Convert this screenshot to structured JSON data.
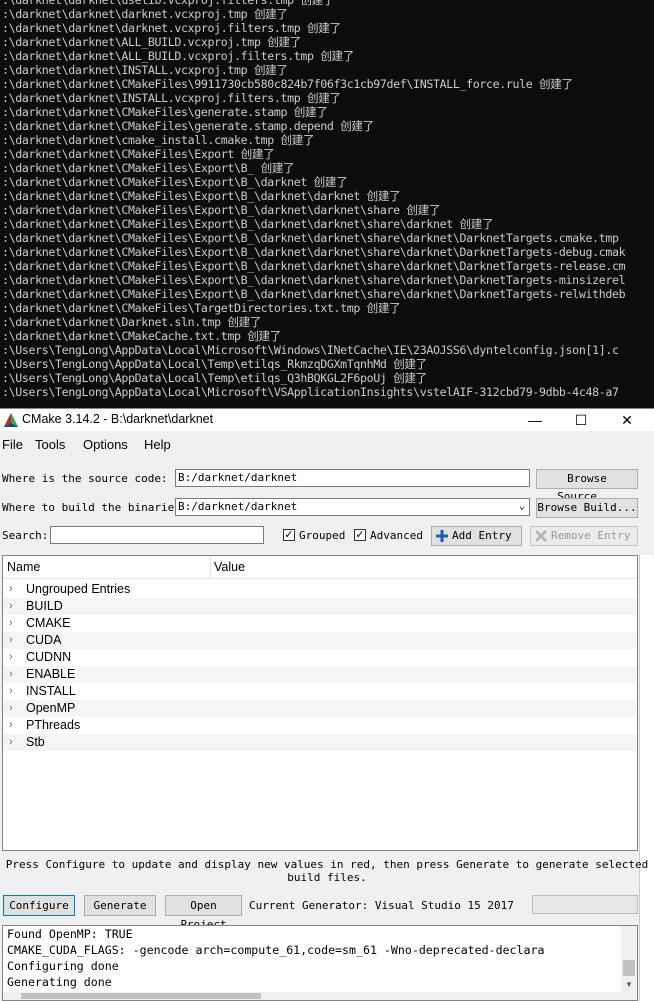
{
  "console": {
    "lines": [
      ":\\darknet\\darknet\\uselib.vcxproj.filters.tmp 创建了",
      ":\\darknet\\darknet\\darknet.vcxproj.tmp 创建了",
      ":\\darknet\\darknet\\darknet.vcxproj.filters.tmp 创建了",
      ":\\darknet\\darknet\\ALL_BUILD.vcxproj.tmp 创建了",
      ":\\darknet\\darknet\\ALL_BUILD.vcxproj.filters.tmp 创建了",
      ":\\darknet\\darknet\\INSTALL.vcxproj.tmp 创建了",
      ":\\darknet\\darknet\\CMakeFiles\\9911730cb580c824b7f06f3c1cb97def\\INSTALL_force.rule 创建了",
      ":\\darknet\\darknet\\INSTALL.vcxproj.filters.tmp 创建了",
      ":\\darknet\\darknet\\CMakeFiles\\generate.stamp 创建了",
      ":\\darknet\\darknet\\CMakeFiles\\generate.stamp.depend 创建了",
      ":\\darknet\\darknet\\cmake_install.cmake.tmp 创建了",
      ":\\darknet\\darknet\\CMakeFiles\\Export 创建了",
      ":\\darknet\\darknet\\CMakeFiles\\Export\\B_ 创建了",
      ":\\darknet\\darknet\\CMakeFiles\\Export\\B_\\darknet 创建了",
      ":\\darknet\\darknet\\CMakeFiles\\Export\\B_\\darknet\\darknet 创建了",
      ":\\darknet\\darknet\\CMakeFiles\\Export\\B_\\darknet\\darknet\\share 创建了",
      ":\\darknet\\darknet\\CMakeFiles\\Export\\B_\\darknet\\darknet\\share\\darknet 创建了",
      ":\\darknet\\darknet\\CMakeFiles\\Export\\B_\\darknet\\darknet\\share\\darknet\\DarknetTargets.cmake.tmp",
      ":\\darknet\\darknet\\CMakeFiles\\Export\\B_\\darknet\\darknet\\share\\darknet\\DarknetTargets-debug.cmak",
      ":\\darknet\\darknet\\CMakeFiles\\Export\\B_\\darknet\\darknet\\share\\darknet\\DarknetTargets-release.cm",
      ":\\darknet\\darknet\\CMakeFiles\\Export\\B_\\darknet\\darknet\\share\\darknet\\DarknetTargets-minsizerel",
      ":\\darknet\\darknet\\CMakeFiles\\Export\\B_\\darknet\\darknet\\share\\darknet\\DarknetTargets-relwithdeb",
      ":\\darknet\\darknet\\CMakeFiles\\TargetDirectories.txt.tmp 创建了",
      ":\\darknet\\darknet\\Darknet.sln.tmp 创建了",
      ":\\darknet\\darknet\\CMakeCache.txt.tmp 创建了",
      ":\\Users\\TengLong\\AppData\\Local\\Microsoft\\Windows\\INetCache\\IE\\23AOJSS6\\dyntelconfig.json[1].c",
      ":\\Users\\TengLong\\AppData\\Local\\Temp\\etilqs_RkmzqDGXmTqnhMd 创建了",
      ":\\Users\\TengLong\\AppData\\Local\\Temp\\etilqs_Q3hBQKGL2F6poUj 创建了",
      ":\\Users\\TengLong\\AppData\\Local\\Microsoft\\VSApplicationInsights\\vstelAIF-312cbd79-9dbb-4c48-a7"
    ]
  },
  "window": {
    "title": "CMake 3.14.2 - B:\\darknet\\darknet",
    "menu": [
      "File",
      "Tools",
      "Options",
      "Help"
    ],
    "source_label": "Where is the source code:",
    "source_value": "B:/darknet/darknet",
    "browse_source": "Browse Source...",
    "build_label": "Where to build the binaries:",
    "build_value": "B:/darknet/darknet",
    "browse_build": "Browse Build...",
    "search_label": "Search:",
    "search_value": "",
    "grouped_label": "Grouped",
    "advanced_label": "Advanced",
    "add_entry": "Add Entry",
    "remove_entry": "Remove Entry",
    "col_name": "Name",
    "col_value": "Value",
    "groups": [
      "Ungrouped Entries",
      "BUILD",
      "CMAKE",
      "CUDA",
      "CUDNN",
      "ENABLE",
      "INSTALL",
      "OpenMP",
      "PThreads",
      "Stb"
    ],
    "hint": "Press Configure to update and display new values in red, then press Generate to generate selected build files.",
    "configure": "Configure",
    "generate": "Generate",
    "open_project": "Open Project",
    "generator": "Current Generator: Visual Studio 15 2017",
    "output": [
      "Found OpenMP: TRUE",
      "CMAKE_CUDA_FLAGS: -gencode arch=compute_61,code=sm_61 -Wno-deprecated-declara",
      "Configuring done",
      "Generating done"
    ]
  }
}
